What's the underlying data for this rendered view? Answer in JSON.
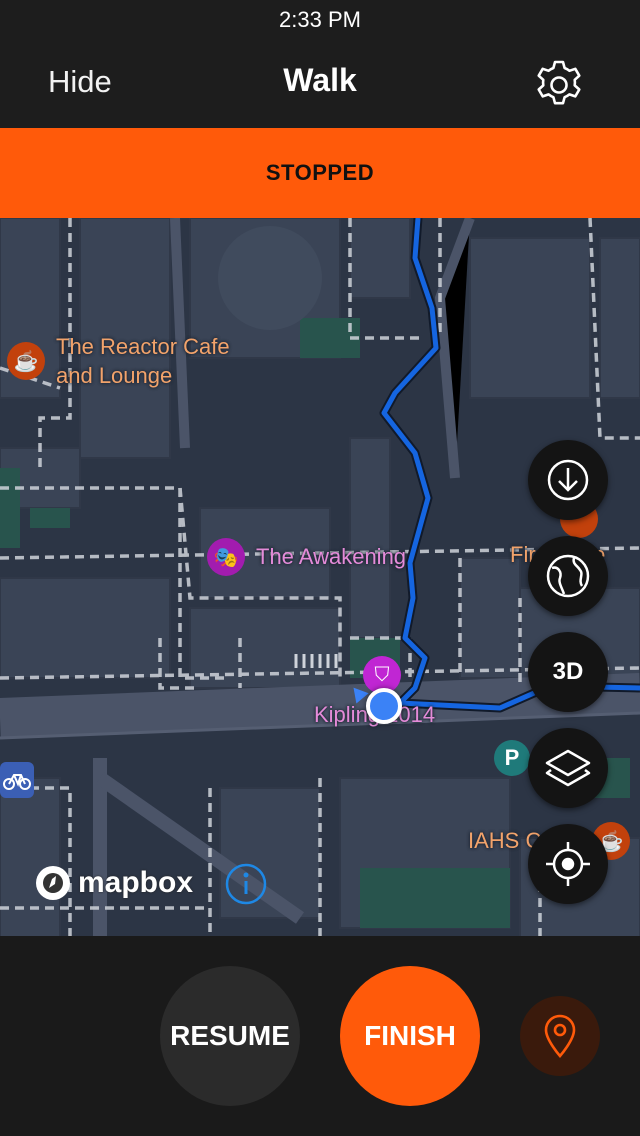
{
  "status_bar": {
    "time": "2:33 PM"
  },
  "nav": {
    "left_label": "Hide",
    "title": "Walk"
  },
  "banner": {
    "text": "STOPPED"
  },
  "map": {
    "labels": {
      "reactor": "The Reactor Cafe\nand Lounge",
      "awakening": "The Awakening",
      "kipling": "Kipling 2014",
      "first_cafe": "First Cafe",
      "iahs": "IAHS C",
      "parking": "P"
    },
    "controls": {
      "download": "download-icon",
      "globe": "globe-icon",
      "three_d": "3D",
      "layers": "layers-icon",
      "locate": "locate-icon"
    },
    "attribution": {
      "logo_text": "mapbox"
    },
    "colors": {
      "route": "#1565e0",
      "user_dot": "#3b82f6",
      "poi_cafe": "#c2410c",
      "poi_theater": "#a21caf"
    }
  },
  "actions": {
    "resume_label": "RESUME",
    "finish_label": "FINISH",
    "pin": "location-pin-icon"
  },
  "theme": {
    "accent": "#ff5a0a",
    "background": "#1b1b1b"
  }
}
